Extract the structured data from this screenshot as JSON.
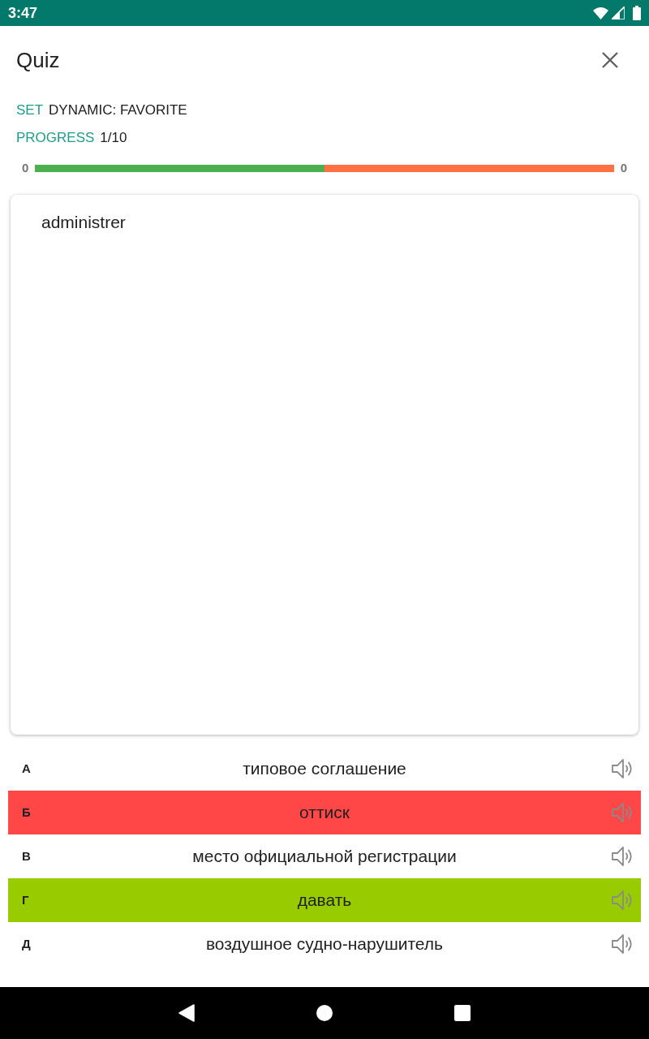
{
  "status_bar": {
    "time": "3:47"
  },
  "header": {
    "title": "Quiz"
  },
  "info": [
    {
      "label": "SET",
      "value": "DYNAMIC: FAVORITE"
    },
    {
      "label": "PROGRESS",
      "value": "1/10"
    }
  ],
  "score": {
    "correct_count": "0",
    "wrong_count": "0",
    "level": 0.5
  },
  "question": {
    "text": "administrer"
  },
  "answers": [
    {
      "letter": "А",
      "text": "типовое соглашение",
      "wrong": false,
      "correct": false
    },
    {
      "letter": "Б",
      "text": "оттиск",
      "wrong": true,
      "correct": false
    },
    {
      "letter": "В",
      "text": "место официальной регистрации",
      "wrong": false,
      "correct": false
    },
    {
      "letter": "Г",
      "text": "давать",
      "wrong": false,
      "correct": true
    },
    {
      "letter": "Д",
      "text": "воздушное судно-нарушитель",
      "wrong": false,
      "correct": false
    }
  ]
}
